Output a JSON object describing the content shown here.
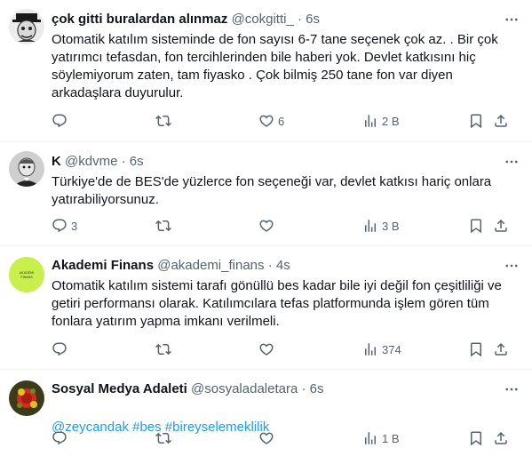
{
  "tweets": [
    {
      "name": "çok gitti buralardan alınmaz",
      "handle": "@cokgitti_",
      "separator": "·",
      "time": "6s",
      "text": "Otomatik katılım sisteminde de fon sayısı 6-7 tane seçenek çok az. . Bir çok yatırımcı tefasdan, fon tercihlerinden bile haberi yok. Devlet katkısını hiç söylemiyorum zaten, tam fiyasko . Çok bilmiş 250 tane fon var diyen arkadaşlara duyurulur.",
      "replies": "",
      "retweets": "",
      "likes": "6",
      "views": "2 B"
    },
    {
      "name": "K",
      "handle": "@kdvme",
      "separator": "·",
      "time": "6s",
      "text": "Türkiye'de de BES'de yüzlerce fon seçeneği var, devlet katkısı hariç onlara yatırabiliyorsunuz.",
      "replies": "3",
      "retweets": "",
      "likes": "",
      "views": "3 B"
    },
    {
      "name": "Akademi Finans",
      "handle": "@akademi_finans",
      "separator": "·",
      "time": "4s",
      "avatar_text": "AKADEMİ FİNANS",
      "text": "Otomatik katılım sistemi tarafı gönüllü bes kadar bile iyi değil fon çeşitliliği ve getiri performansı olarak. Katılımcılara tefas platformunda işlem gören tüm fonlara yatırım yapma imkanı verilmeli.",
      "replies": "",
      "retweets": "",
      "likes": "",
      "views": "374"
    },
    {
      "name": "Sosyal Medya Adaleti",
      "handle": "@sosyaladaletara",
      "separator": "·",
      "time": "6s",
      "text": "@zeycandak #bes #bireyselemeklilik",
      "replies": "",
      "retweets": "",
      "likes": "",
      "views": "1 B"
    }
  ],
  "colors": {
    "text": "#0f1419",
    "muted": "#536471",
    "link": "#1d9bf0",
    "divider": "#eff3f4"
  },
  "icons": [
    "reply-icon",
    "retweet-icon",
    "like-icon",
    "views-icon",
    "bookmark-icon",
    "share-icon",
    "more-icon"
  ]
}
